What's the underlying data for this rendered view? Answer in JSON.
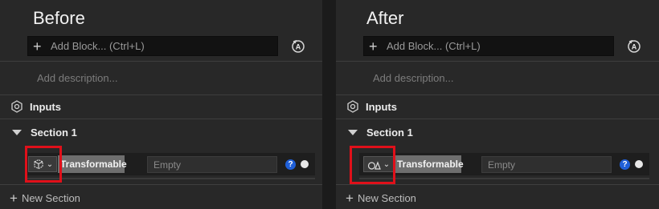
{
  "left": {
    "title": "Before",
    "add_block": "Add Block... (Ctrl+L)",
    "description_placeholder": "Add description...",
    "inputs_label": "Inputs",
    "section_label": "Section 1",
    "param_name": "Transformable",
    "param_value": "Empty",
    "help_glyph": "?",
    "new_section": "New Section",
    "type_icon": "transform-cube-icon"
  },
  "right": {
    "title": "After",
    "add_block": "Add Block... (Ctrl+L)",
    "description_placeholder": "Add description...",
    "inputs_label": "Inputs",
    "section_label": "Section 1",
    "param_name": "Transformable",
    "param_value": "Empty",
    "help_glyph": "?",
    "new_section": "New Section",
    "type_icon": "shapes-icon"
  },
  "colors": {
    "highlight": "#e0101a",
    "help": "#1f5fd8"
  }
}
